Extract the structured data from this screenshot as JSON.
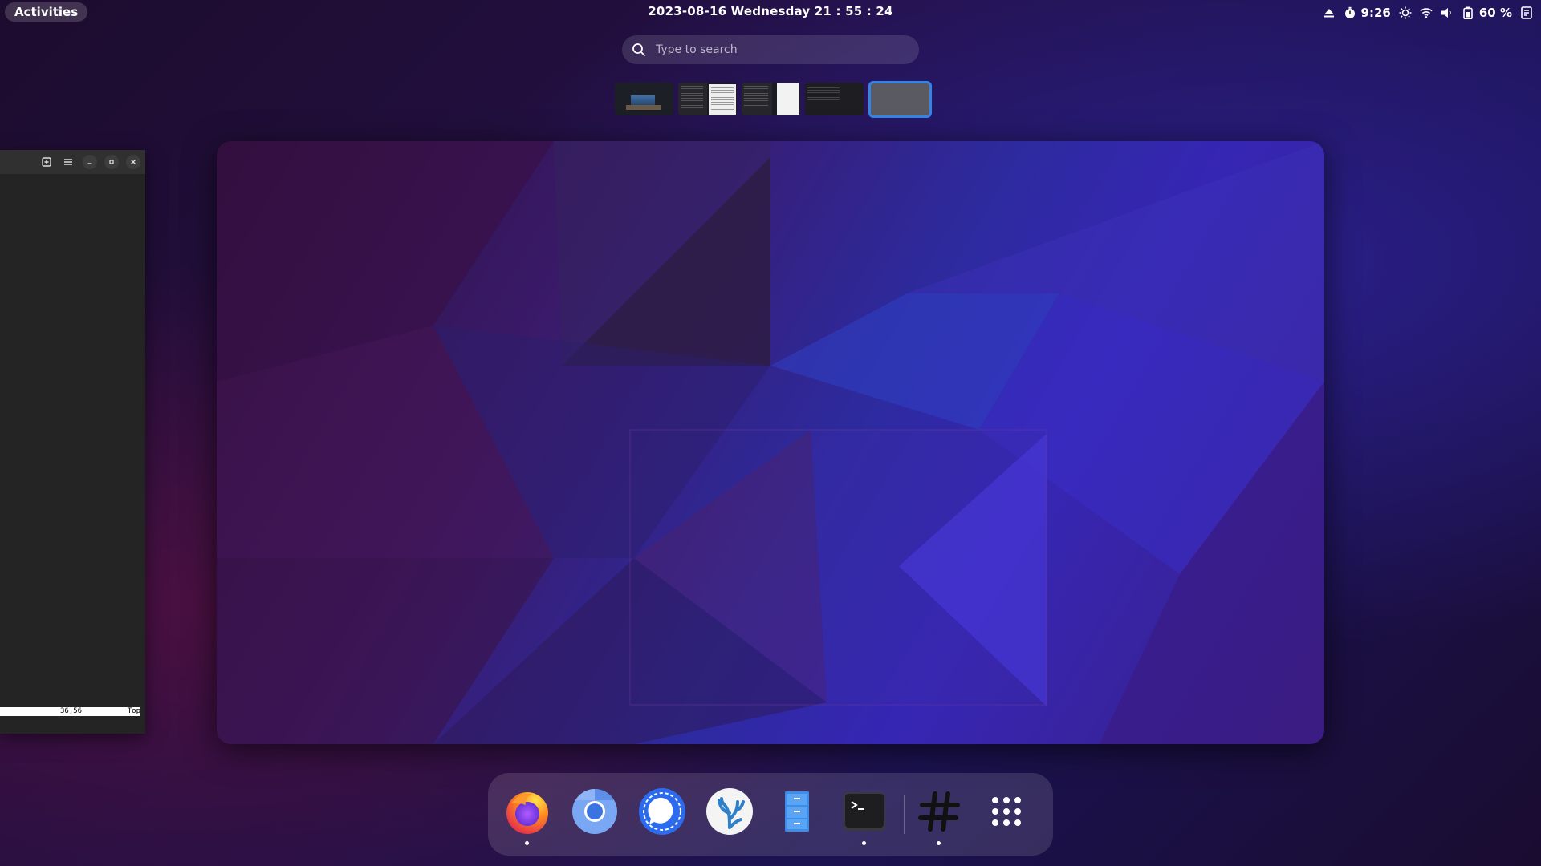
{
  "topbar": {
    "activities_label": "Activities",
    "clock": "2023-08-16  Wednesday  21 : 55 : 24",
    "tray": {
      "eject_icon": "eject-icon",
      "timer_icon": "stopwatch-icon",
      "timer_value": "9:26",
      "brightness_icon": "brightness-icon",
      "wifi_icon": "wifi-icon",
      "volume_icon": "volume-icon",
      "battery_icon": "battery-icon",
      "battery_percent": "60 %",
      "notes_icon": "notes-icon"
    }
  },
  "search": {
    "placeholder": "Type to search",
    "icon": "search-icon"
  },
  "workspaces": [
    {
      "name": "workspace-1",
      "active": false
    },
    {
      "name": "workspace-2",
      "active": false
    },
    {
      "name": "workspace-3",
      "active": false
    },
    {
      "name": "workspace-4",
      "active": false
    },
    {
      "name": "workspace-5",
      "active": true
    }
  ],
  "side_window": {
    "status_position": "36,56",
    "status_scroll": "Top"
  },
  "dock": {
    "items": [
      {
        "name": "firefox",
        "icon": "firefox-icon",
        "running": true
      },
      {
        "name": "chromium",
        "icon": "chromium-icon",
        "running": false
      },
      {
        "name": "signal",
        "icon": "signal-icon",
        "running": false
      },
      {
        "name": "vscodium",
        "icon": "vscodium-icon",
        "running": false
      },
      {
        "name": "files",
        "icon": "file-cabinet-icon",
        "running": false
      },
      {
        "name": "terminal",
        "icon": "terminal-icon",
        "running": true
      },
      {
        "name": "slack-hash",
        "icon": "hash-icon",
        "running": true
      },
      {
        "name": "app-grid",
        "icon": "app-grid-icon",
        "running": false
      }
    ]
  },
  "colors": {
    "accent": "#3584e4"
  }
}
